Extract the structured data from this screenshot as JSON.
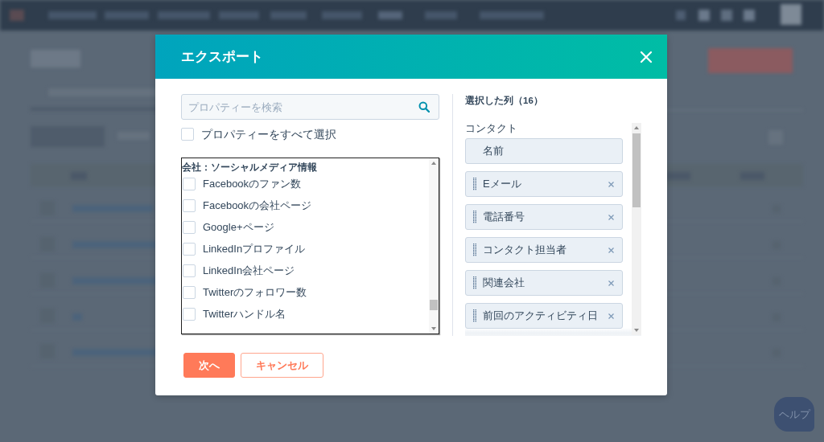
{
  "header": {
    "title": "エクスポート"
  },
  "search": {
    "placeholder": "プロパティーを検索"
  },
  "select_all": {
    "label": "プロパティーをすべて選択",
    "checked": false
  },
  "property_list": {
    "group": "会社：ソーシャルメディア情報",
    "items": [
      {
        "label": "Facebookのファン数",
        "checked": false
      },
      {
        "label": "Facebookの会社ページ",
        "checked": false
      },
      {
        "label": "Google+ページ",
        "checked": false
      },
      {
        "label": "LinkedInプロファイル",
        "checked": false
      },
      {
        "label": "LinkedIn会社ページ",
        "checked": false
      },
      {
        "label": "Twitterのフォロワー数",
        "checked": false
      },
      {
        "label": "Twitterハンドル名",
        "checked": false
      }
    ]
  },
  "selected_columns": {
    "title": "選択した列（16）",
    "group": "コンタクト",
    "items": [
      {
        "label": "名前",
        "removable": false
      },
      {
        "label": "Eメール",
        "removable": true
      },
      {
        "label": "電話番号",
        "removable": true
      },
      {
        "label": "コンタクト担当者",
        "removable": true
      },
      {
        "label": "関連会社",
        "removable": true
      },
      {
        "label": "前回のアクティビティ日",
        "removable": true
      }
    ]
  },
  "buttons": [
    {
      "label": "次へ",
      "kind": "primary"
    },
    {
      "label": "キャンセル",
      "kind": "secondary"
    }
  ],
  "help_button": {
    "label": "ヘルプ"
  }
}
